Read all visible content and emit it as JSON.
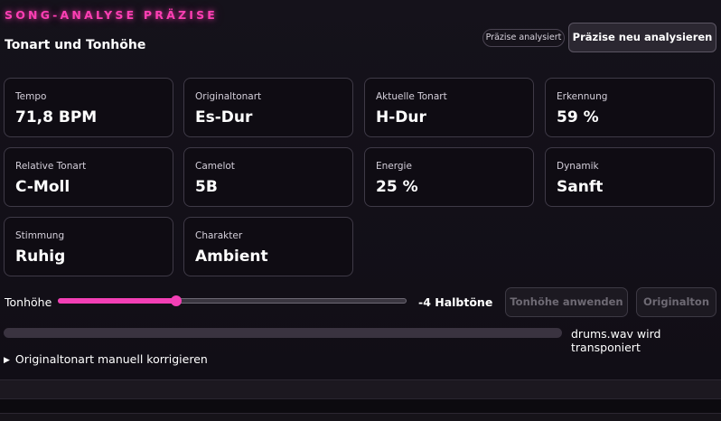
{
  "header": {
    "section_title": "SONG-ANALYSE PRÄZISE",
    "subtitle": "Tonart und Tonhöhe",
    "badge": "Präzise analysiert",
    "reanalyze_button": "Präzise neu analysieren"
  },
  "cards": [
    {
      "label": "Tempo",
      "value": "71,8 BPM"
    },
    {
      "label": "Originaltonart",
      "value": "Es-Dur"
    },
    {
      "label": "Aktuelle Tonart",
      "value": "H-Dur"
    },
    {
      "label": "Erkennung",
      "value": "59 %"
    },
    {
      "label": "Relative Tonart",
      "value": "C-Moll"
    },
    {
      "label": "Camelot",
      "value": "5B"
    },
    {
      "label": "Energie",
      "value": "25 %"
    },
    {
      "label": "Dynamik",
      "value": "Sanft"
    },
    {
      "label": "Stimmung",
      "value": "Ruhig"
    },
    {
      "label": "Charakter",
      "value": "Ambient"
    }
  ],
  "pitch": {
    "label": "Tonhöhe",
    "value_text": "-4 Halbtöne",
    "slider_fraction": 0.34,
    "apply_button": "Tonhöhe anwenden",
    "original_button": "Originalton"
  },
  "status": {
    "progress_text": "drums.wav wird transponiert",
    "progress_fraction": 0
  },
  "disclosure": {
    "icon": "triangle-right-icon",
    "label": "Originaltonart manuell korrigieren"
  },
  "colors": {
    "accent": "#f23fb5",
    "title_glow": "#ff3fb4",
    "background": "#120f17"
  }
}
